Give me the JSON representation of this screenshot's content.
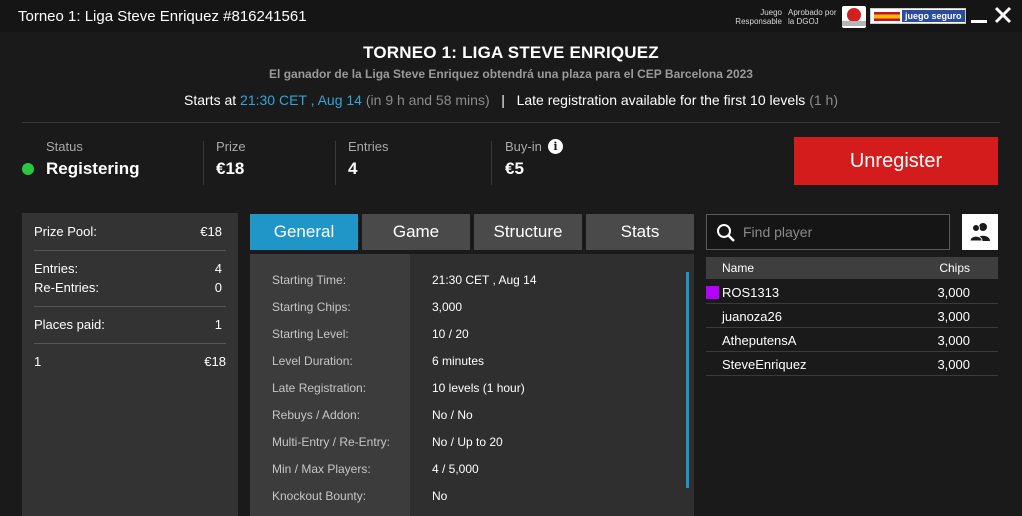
{
  "window": {
    "title": "Torneo 1: Liga Steve Enriquez #816241561",
    "logos": {
      "responsible": "Juego Responsable",
      "dgoj": "Aprobado por la DGOJ",
      "juego_seguro": "juego seguro"
    }
  },
  "header": {
    "name": "TORNEO 1: LIGA STEVE ENRIQUEZ",
    "subtitle": "El ganador de la Liga Steve Enriquez obtendrá una plaza para el CEP Barcelona 2023",
    "starts_prefix": "Starts at",
    "start_time": "21:30 CET , Aug 14",
    "countdown": "(in 9 h and 58 mins)",
    "separator": "|",
    "late_reg_text": "Late registration available for the first 10 levels",
    "late_reg_duration": "(1 h)"
  },
  "summary": {
    "status_label": "Status",
    "status_value": "Registering",
    "status_color": "#29c840",
    "prize_label": "Prize",
    "prize_value": "€18",
    "entries_label": "Entries",
    "entries_value": "4",
    "buyin_label": "Buy-in",
    "buyin_value": "€5",
    "unregister_label": "Unregister",
    "unregister_color": "#d41c1c"
  },
  "left_panel": {
    "prize_pool_label": "Prize Pool:",
    "prize_pool_value": "€18",
    "entries_label": "Entries:",
    "entries_value": "4",
    "reentries_label": "Re-Entries:",
    "reentries_value": "0",
    "places_paid_label": "Places paid:",
    "places_paid_value": "1",
    "payouts": [
      {
        "place": "1",
        "amount": "€18"
      }
    ]
  },
  "tabs": [
    {
      "label": "General",
      "active": true
    },
    {
      "label": "Game",
      "active": false
    },
    {
      "label": "Structure",
      "active": false
    },
    {
      "label": "Stats",
      "active": false
    }
  ],
  "details": [
    {
      "label": "Starting Time:",
      "value": "21:30 CET , Aug 14"
    },
    {
      "label": "Starting Chips:",
      "value": "3,000"
    },
    {
      "label": "Starting Level:",
      "value": "10 / 20"
    },
    {
      "label": "Level Duration:",
      "value": "6 minutes"
    },
    {
      "label": "Late Registration:",
      "value": "10 levels (1 hour)"
    },
    {
      "label": "Rebuys / Addon:",
      "value": "No / No"
    },
    {
      "label": "Multi-Entry / Re-Entry:",
      "value": "No / Up to 20"
    },
    {
      "label": "Min / Max Players:",
      "value": "4 / 5,000"
    },
    {
      "label": "Knockout Bounty:",
      "value": "No"
    }
  ],
  "players": {
    "search_placeholder": "Find player",
    "col_name": "Name",
    "col_chips": "Chips",
    "highlight_color": "#b400ff",
    "rows": [
      {
        "name": "ROS1313",
        "chips": "3,000",
        "highlight": true
      },
      {
        "name": "juanoza26",
        "chips": "3,000",
        "highlight": false
      },
      {
        "name": "AtheputensA",
        "chips": "3,000",
        "highlight": false
      },
      {
        "name": "SteveEnriquez",
        "chips": "3,000",
        "highlight": false
      }
    ]
  },
  "icons": {
    "minimize": "minimize-icon",
    "close": "close-icon",
    "status": "status-dot-icon",
    "info": "info-icon",
    "search": "search-icon",
    "players": "players-icon"
  }
}
